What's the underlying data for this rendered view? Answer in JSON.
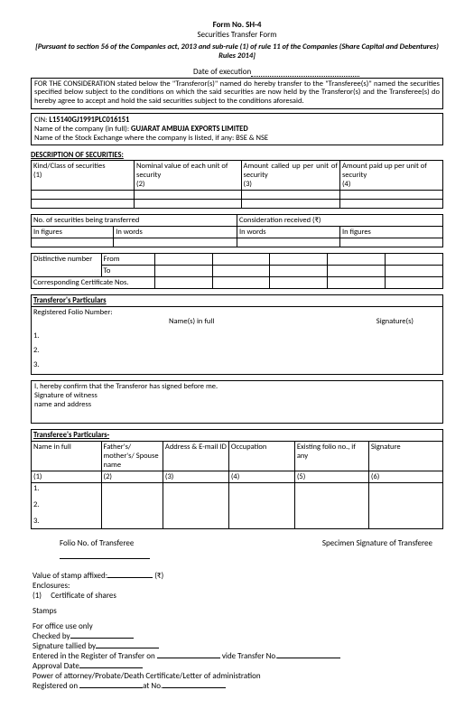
{
  "header": {
    "form_no": "Form No. SH-4",
    "subtitle": "Securities Transfer Form",
    "legal": "[Pursuant to section 56 of the Companies act, 2013 and sub-rule (1) of rule 11 of the Companies (Share Capital and Debentures) Rules 2014]"
  },
  "exec_label": "Date of execution",
  "consideration_text": "FOR THE CONSIDERATION stated below the \"Transferor(s)\" named do hereby transfer to the \"Transferee(s)\" named the securities specified below subject to the conditions on which the said securities are now held by the Transferor(s) and the Transferee(s) do hereby agree to accept and hold the said securities subject to the conditions aforesaid.",
  "company_box": {
    "cin_label": "CIN:",
    "cin": "L15140GJ1991PLC016151",
    "name_label": "Name of the company (in full):",
    "name": "GUJARAT AMBUJA EXPORTS LIMITED",
    "exchange_label": "Name of the Stock Exchange where the company is listed, if any:",
    "exchange": "BSE & NSE"
  },
  "desc_sec": {
    "heading": "DESCRIPTION OF SECURITIES:",
    "col1": "Kind/Class of securities",
    "col1n": "(1)",
    "col2": "Nominal value of each unit of security",
    "col2n": "(2)",
    "col3": "Amount called up per unit of security",
    "col3n": "(3)",
    "col4": "Amount paid up per unit of security",
    "col4n": "(4)"
  },
  "transfer_block": {
    "sec_transferred": "No. of securities being transferred",
    "consideration": "Consideration received (₹)",
    "in_figures": "In figures",
    "in_words": "In words"
  },
  "distinctive": {
    "label": "Distinctive number",
    "from": "From",
    "to": "To",
    "cert": "Corresponding Certificate Nos."
  },
  "transferor": {
    "heading": "Transferor's Particulars",
    "folio": "Registered Folio Number:",
    "names": "Name(s) in full",
    "sigs": "Signature(s)",
    "n1": "1.",
    "n2": "2.",
    "n3": "3."
  },
  "witness": {
    "confirm": "I, hereby confirm that the Transferor has signed before me.",
    "sig": "Signature of witness",
    "addr": "name and address"
  },
  "transferee": {
    "heading": "Transferee's Particulars-",
    "c1": "Name in full",
    "c1n": "(1)",
    "c2": "Father's/ mother's/ Spouse name",
    "c2n": "(2)",
    "c3": "Address & E-mail ID",
    "c3n": "(3)",
    "c4": "Occupation",
    "c4n": "(4)",
    "c5": "Existing folio no., if any",
    "c5n": "(5)",
    "c6": "Signature",
    "c6n": "(6)",
    "r1": "1.",
    "r2": "2.",
    "r3": "3."
  },
  "footer": {
    "folio_transferee": "Folio No. of Transferee",
    "specimen_sig": "Specimen Signature of Transferee",
    "stamp_label": "Value of stamp affixed:",
    "rupee": "(₹)",
    "enclosures": "Enclosures:",
    "enc1": "(1)     Certificate of shares",
    "stamps": "Stamps",
    "office_use": "For office use only",
    "checked": "Checked by",
    "tallied": "Signature tallied by",
    "entered1": "Entered in the Register of Transfer on",
    "entered2": "vide Transfer No.",
    "approval": "Approval Date",
    "poa": "Power of attorney/Probate/Death Certificate/Letter of administration",
    "registered": "Registered on",
    "at_no": "at No."
  }
}
